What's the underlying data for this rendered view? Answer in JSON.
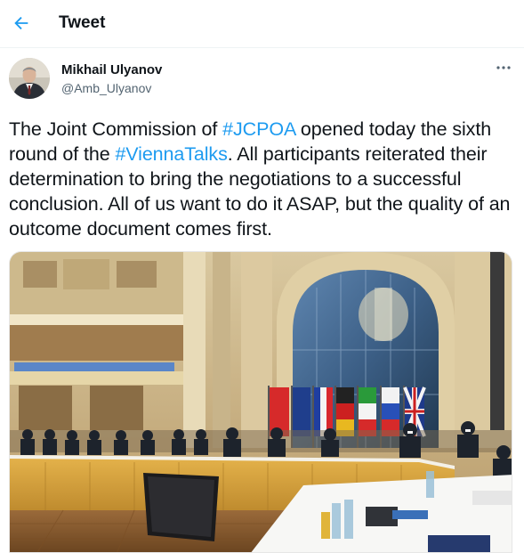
{
  "header": {
    "title": "Tweet",
    "back_icon": "arrow-left-icon"
  },
  "author": {
    "name": "Mikhail Ulyanov",
    "handle": "@Amb_Ulyanov",
    "more_icon": "more-horizontal-icon"
  },
  "tweet": {
    "segments": [
      {
        "text": "The Joint Commission of ",
        "type": "plain"
      },
      {
        "text": "#JCPOA",
        "type": "hashtag"
      },
      {
        "text": " opened today the sixth round of the ",
        "type": "plain"
      },
      {
        "text": "#ViennaTalks",
        "type": "hashtag"
      },
      {
        "text": ". All participants reiterated their determination to bring the negotiations to a successful conclusion. All of us want to do it ASAP, but the quality of an outcome document comes first.",
        "type": "plain"
      }
    ]
  },
  "colors": {
    "accent": "#1d9bf0",
    "text_primary": "#0f1419",
    "text_secondary": "#536471"
  }
}
